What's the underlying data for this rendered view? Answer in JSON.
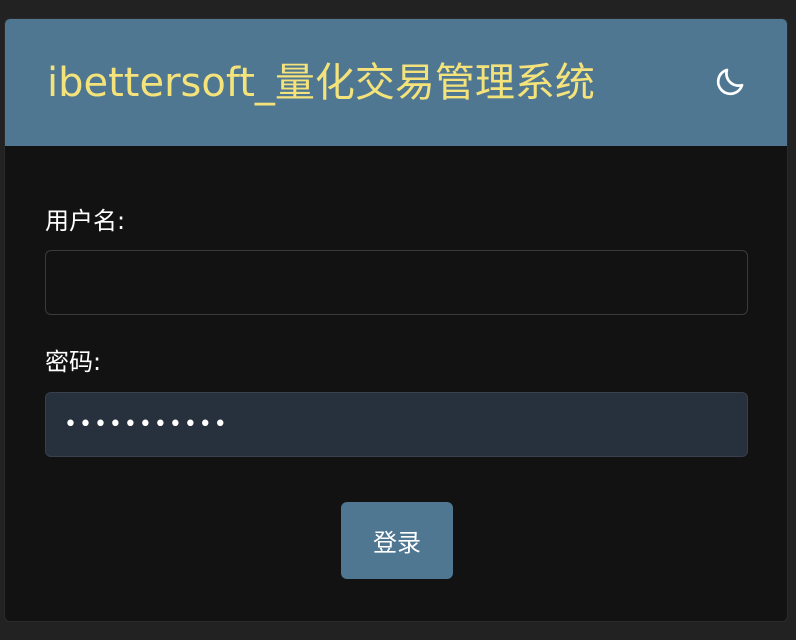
{
  "app": {
    "title": "ibettersoft_量化交易管理系统"
  },
  "header": {
    "theme_toggle_icon": "moon-icon"
  },
  "form": {
    "username_label": "用户名:",
    "username_value": "",
    "password_label": "密码:",
    "password_value": "•••••••••••",
    "submit_label": "登录"
  },
  "colors": {
    "header_bg": "#4f7792",
    "title_text": "#f4e27a",
    "page_bg": "#121212",
    "password_field_bg": "#27303d",
    "button_bg": "#4f7792"
  }
}
